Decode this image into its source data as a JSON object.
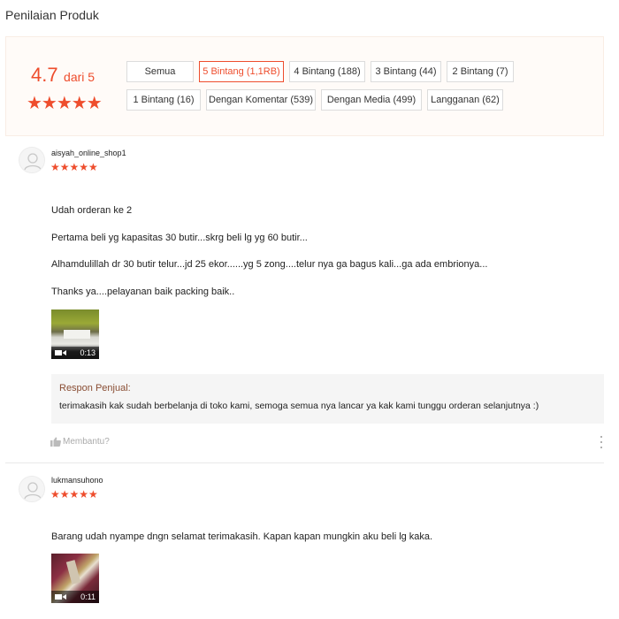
{
  "section_title": "Penilaian Produk",
  "summary": {
    "rating": "4.7",
    "out_of": "dari 5",
    "stars": "★★★★★",
    "filters": [
      {
        "label": "Semua",
        "active": false
      },
      {
        "label": "5 Bintang (1,1RB)",
        "active": true
      },
      {
        "label": "4 Bintang (188)",
        "active": false
      },
      {
        "label": "3 Bintang (44)",
        "active": false
      },
      {
        "label": "2 Bintang (7)",
        "active": false
      },
      {
        "label": "1 Bintang (16)",
        "active": false
      },
      {
        "label": "Dengan Komentar (539)",
        "active": false
      },
      {
        "label": "Dengan Media (499)",
        "active": false
      },
      {
        "label": "Langganan (62)",
        "active": false
      }
    ]
  },
  "reviews": [
    {
      "username": "aisyah_online_shop1",
      "stars": "★★★★★",
      "lines": [
        "Udah orderan ke 2",
        "Pertama beli yg kapasitas 30 butir...skrg beli lg yg 60 butir...",
        "Alhamdulillah dr 30 butir telur...jd 25 ekor......yg 5 zong....telur nya ga bagus kali...ga ada embrionya...",
        "Thanks ya....pelayanan baik packing baik.."
      ],
      "video_duration": "0:13",
      "seller_response": {
        "label": "Respon Penjual:",
        "text": "terimakasih kak sudah berbelanja di toko kami, semoga semua nya lancar ya kak kami tunggu orderan selanjutnya :)"
      },
      "helpful_label": "Membantu?"
    },
    {
      "username": "lukmansuhono",
      "stars": "★★★★★",
      "lines": [
        "Barang udah nyampe dngn selamat terimakasih. Kapan kapan mungkin aku beli lg kaka."
      ],
      "video_duration": "0:11"
    }
  ],
  "colors": {
    "accent": "#ee4d2d",
    "summary_bg": "#fffbf8",
    "seller_label": "#894d33",
    "seller_bg": "#f5f5f5"
  },
  "icons": {
    "avatar": "user-avatar-icon",
    "video": "video-camera-icon",
    "helpful": "thumbs-up-icon",
    "more": "more-vertical-icon"
  }
}
